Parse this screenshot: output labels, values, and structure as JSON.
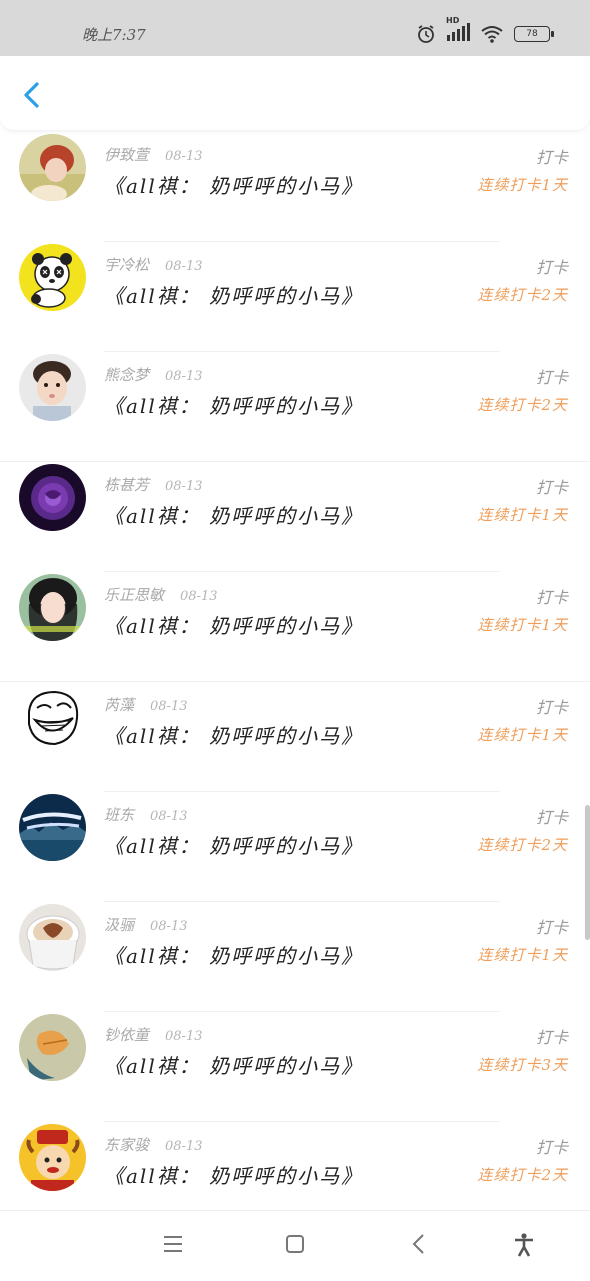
{
  "status_bar": {
    "time": "晚上7:37",
    "network": "HD",
    "battery": "78"
  },
  "header": {
    "back_icon": "chevron-left-icon",
    "accent_color": "#2aa0e6"
  },
  "list": {
    "items": [
      {
        "name": "伊致萱",
        "date": "08-13",
        "title": "《all祺： 奶呼呼的小马》",
        "action": "打卡",
        "streak": "连续打卡1天",
        "avatar": "red-haired-girl"
      },
      {
        "name": "宇冷松",
        "date": "08-13",
        "title": "《all祺： 奶呼呼的小马》",
        "action": "打卡",
        "streak": "连续打卡2天",
        "avatar": "cartoon-panda"
      },
      {
        "name": "熊念梦",
        "date": "08-13",
        "title": "《all祺： 奶呼呼的小马》",
        "action": "打卡",
        "streak": "连续打卡2天",
        "avatar": "child-face"
      },
      {
        "name": "栋甚芳",
        "date": "08-13",
        "title": "《all祺： 奶呼呼的小马》",
        "action": "打卡",
        "streak": "连续打卡1天",
        "avatar": "purple-rose"
      },
      {
        "name": "乐正思敏",
        "date": "08-13",
        "title": "《all祺： 奶呼呼的小马》",
        "action": "打卡",
        "streak": "连续打卡1天",
        "avatar": "girl-dark-hair"
      },
      {
        "name": "芮藻",
        "date": "08-13",
        "title": "《all祺： 奶呼呼的小马》",
        "action": "打卡",
        "streak": "连续打卡1天",
        "avatar": "troll-face"
      },
      {
        "name": "班东",
        "date": "08-13",
        "title": "《all祺： 奶呼呼的小马》",
        "action": "打卡",
        "streak": "连续打卡2天",
        "avatar": "city-poster"
      },
      {
        "name": "汲骊",
        "date": "08-13",
        "title": "《all祺： 奶呼呼的小马》",
        "action": "打卡",
        "streak": "连续打卡1天",
        "avatar": "latte-art"
      },
      {
        "name": "钞依童",
        "date": "08-13",
        "title": "《all祺： 奶呼呼的小马》",
        "action": "打卡",
        "streak": "连续打卡3天",
        "avatar": "autumn-leaf"
      },
      {
        "name": "东家骏",
        "date": "08-13",
        "title": "《all祺： 奶呼呼的小马》",
        "action": "打卡",
        "streak": "连续打卡2天",
        "avatar": "cartoon-bull"
      }
    ]
  },
  "nav_bar": {
    "menu_icon": "menu-icon",
    "home_icon": "home-square-icon",
    "back_icon": "back-triangle-icon",
    "accessibility_icon": "accessibility-icon"
  },
  "colors": {
    "streak": "#ef9e5a",
    "status_bar_bg": "#d9d9d9"
  }
}
